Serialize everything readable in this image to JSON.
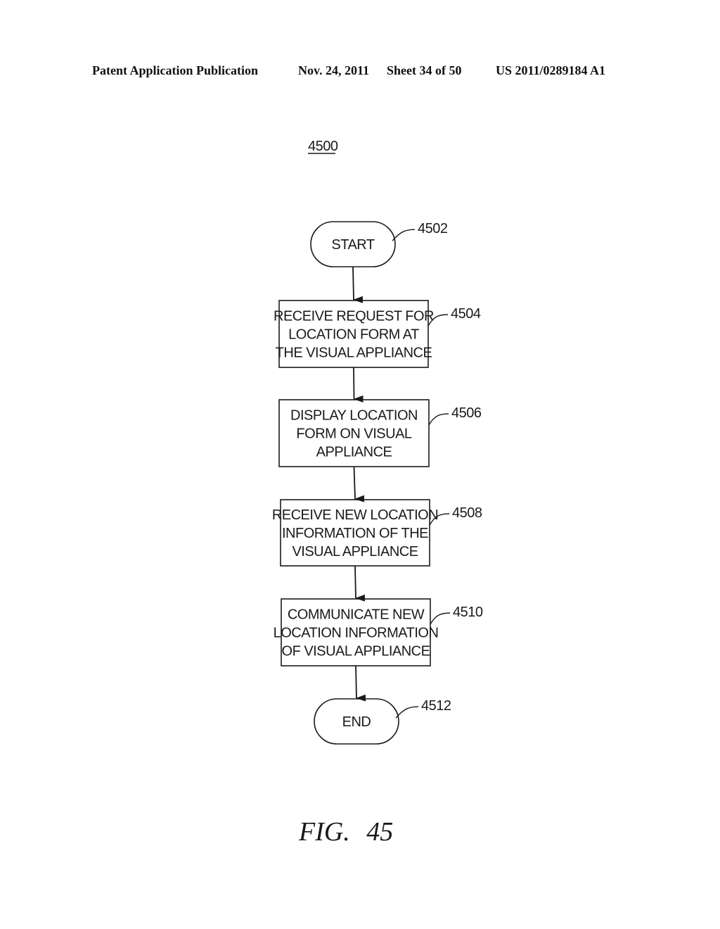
{
  "header": {
    "publication": "Patent Application Publication",
    "date": "Nov. 24, 2011",
    "sheet": "Sheet 34 of 50",
    "number": "US 2011/0289184 A1"
  },
  "figure": {
    "reference": "4500",
    "caption": "FIG. 45"
  },
  "flowchart": {
    "nodes": [
      {
        "id": "4502",
        "type": "terminal",
        "lines": [
          "START"
        ]
      },
      {
        "id": "4504",
        "type": "process",
        "lines": [
          "RECEIVE REQUEST FOR",
          "LOCATION FORM AT",
          "THE VISUAL APPLIANCE"
        ]
      },
      {
        "id": "4506",
        "type": "process",
        "lines": [
          "DISPLAY LOCATION",
          "FORM ON VISUAL",
          "APPLIANCE"
        ]
      },
      {
        "id": "4508",
        "type": "process",
        "lines": [
          "RECEIVE NEW LOCATION",
          "INFORMATION OF THE",
          "VISUAL APPLIANCE"
        ]
      },
      {
        "id": "4510",
        "type": "process",
        "lines": [
          "COMMUNICATE NEW",
          "LOCATION INFORMATION",
          "OF VISUAL APPLIANCE"
        ]
      },
      {
        "id": "4512",
        "type": "terminal",
        "lines": [
          "END"
        ]
      }
    ],
    "edges": [
      {
        "from": "4502",
        "to": "4504"
      },
      {
        "from": "4504",
        "to": "4506"
      },
      {
        "from": "4506",
        "to": "4508"
      },
      {
        "from": "4508",
        "to": "4510"
      },
      {
        "from": "4510",
        "to": "4512"
      }
    ]
  }
}
